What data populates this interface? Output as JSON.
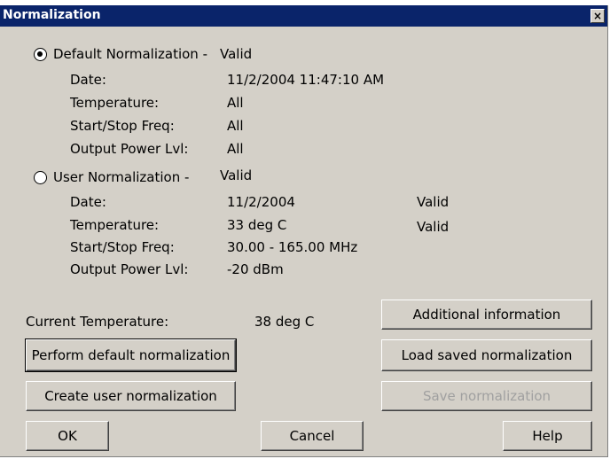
{
  "window": {
    "title": "Normalization",
    "close_glyph": "×"
  },
  "default_norm": {
    "label": "Default Normalization -",
    "status": "Valid",
    "selected": true,
    "rows": [
      {
        "label": "Date:",
        "value": "11/2/2004 11:47:10 AM"
      },
      {
        "label": "Temperature:",
        "value": "All"
      },
      {
        "label": "Start/Stop Freq:",
        "value": "All"
      },
      {
        "label": "Output Power Lvl:",
        "value": "All"
      }
    ]
  },
  "user_norm": {
    "label": "User Normalization  -",
    "status": "Valid",
    "selected": false,
    "rows": [
      {
        "label": "Date:",
        "value": "11/2/2004",
        "status": "Valid"
      },
      {
        "label": "Temperature:",
        "value": "33 deg C",
        "status": "Valid"
      },
      {
        "label": "Start/Stop Freq:",
        "value": "30.00 - 165.00  MHz",
        "status": ""
      },
      {
        "label": "Output Power Lvl:",
        "value": "-20 dBm",
        "status": ""
      }
    ]
  },
  "current_temp": {
    "label": "Current Temperature:",
    "value": "38 deg C"
  },
  "buttons": {
    "additional_info": "Additional information",
    "perform_default": "Perform default normalization",
    "load_saved": "Load saved normalization",
    "create_user": "Create user normalization",
    "save_norm": "Save normalization",
    "ok": "OK",
    "cancel": "Cancel",
    "help": "Help"
  }
}
